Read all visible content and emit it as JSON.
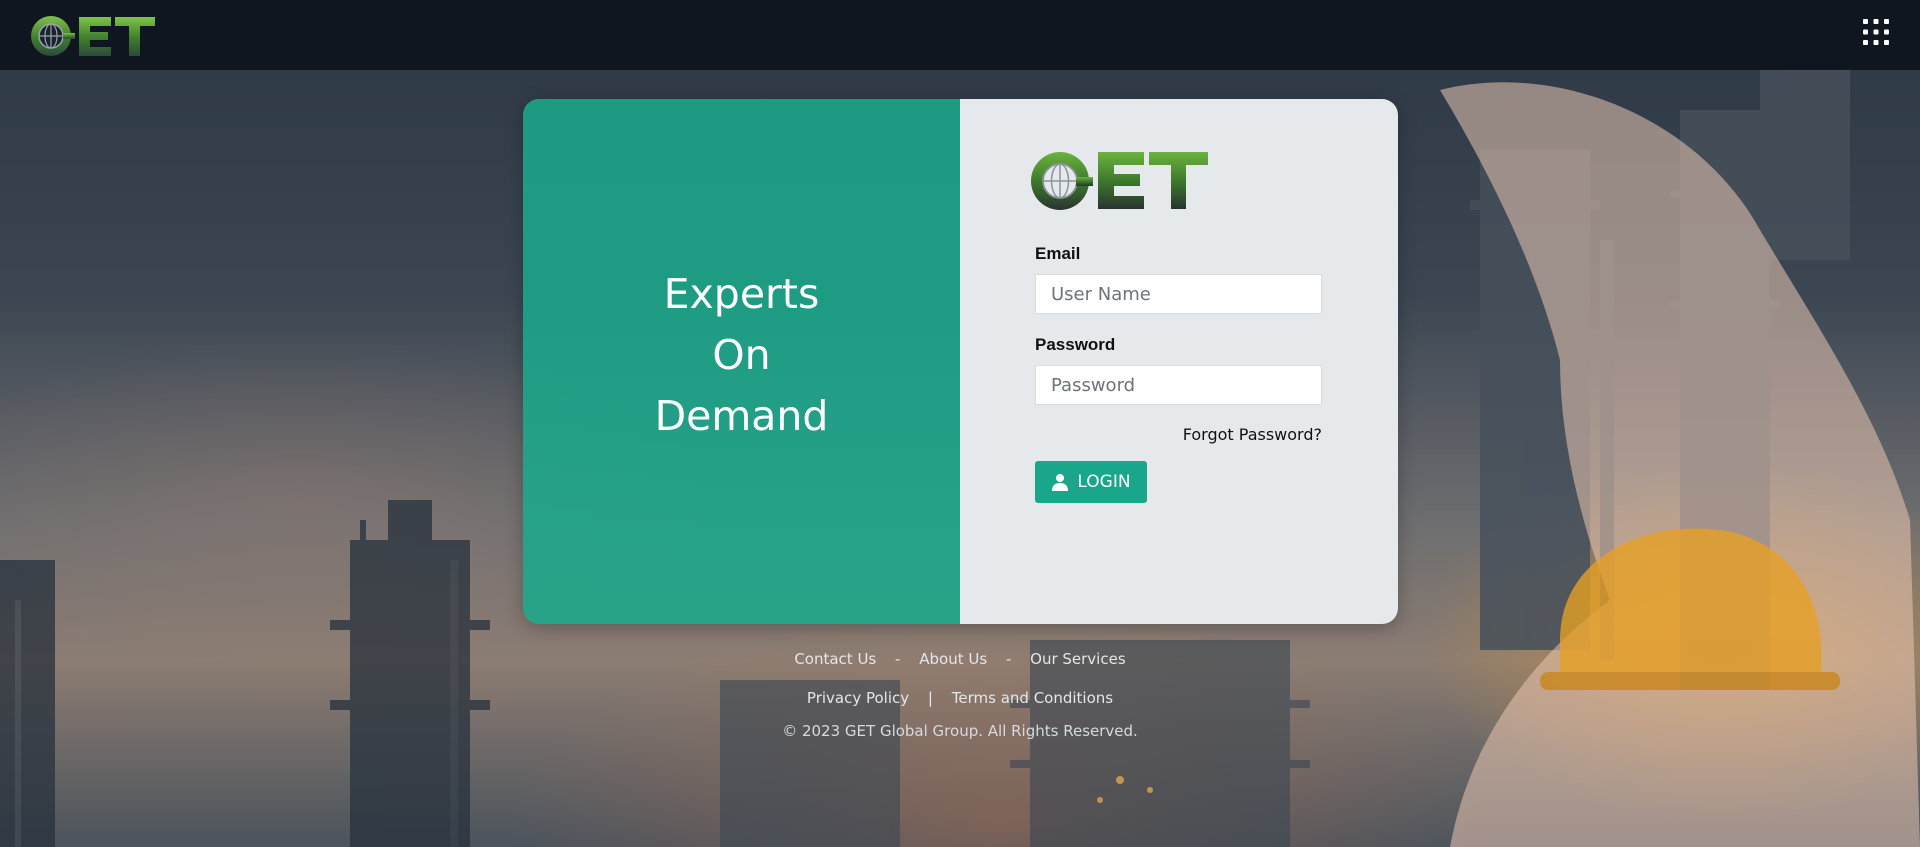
{
  "header": {
    "logo_text": "GET",
    "apps_icon": "grid-icon"
  },
  "hero": {
    "lines": [
      "Experts",
      "On",
      "Demand"
    ]
  },
  "login_form": {
    "logo_text": "GET",
    "email_label": "Email",
    "email_placeholder": "User Name",
    "email_value": "",
    "password_label": "Password",
    "password_placeholder": "Password",
    "password_value": "",
    "forgot_password": "Forgot Password?",
    "login_button": "LOGIN",
    "login_icon": "user-icon"
  },
  "footer": {
    "links": [
      "Contact Us",
      "About Us",
      "Our Services"
    ],
    "link_separator": "-",
    "legal": [
      "Privacy Policy",
      "Terms and Conditions"
    ],
    "legal_separator": "|",
    "copyright": "© 2023 GET Global Group. All Rights Reserved."
  },
  "colors": {
    "navbar": "#0f161f",
    "accent": "#1aa68a",
    "panel_teal": "#1aaa8c",
    "form_bg": "#e6e9ec",
    "logo_green": "#5fa83a"
  }
}
